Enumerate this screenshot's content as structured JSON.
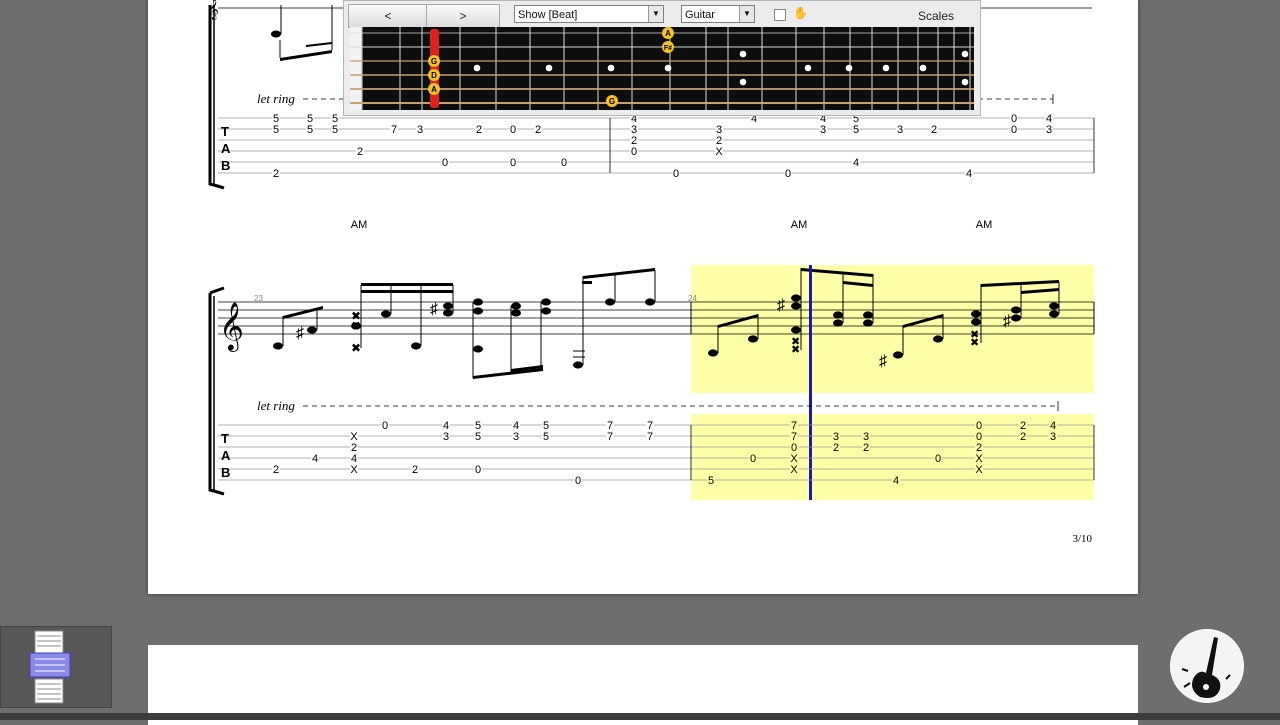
{
  "toolbar": {
    "prev_label": "<",
    "next_label": ">",
    "show_select": "Show [Beat]",
    "instrument_select": "Guitar",
    "scales_label": "Scales"
  },
  "fretboard": {
    "string_markers": [
      "G",
      "D",
      "A"
    ],
    "note_markers": [
      "A",
      "F#",
      "G"
    ]
  },
  "score": {
    "let_ring_label": "let ring",
    "chord_labels": [
      "AM",
      "AM",
      "AM"
    ],
    "measure_numbers": [
      "23",
      "24"
    ],
    "page_number": "3/10",
    "tab_letters": [
      "T",
      "A",
      "B"
    ]
  },
  "colors": {
    "highlight": "#ffffa8",
    "cursor": "#1a1ab0",
    "fret_marker": "#f6c21c",
    "fret_current": "#e02020"
  }
}
